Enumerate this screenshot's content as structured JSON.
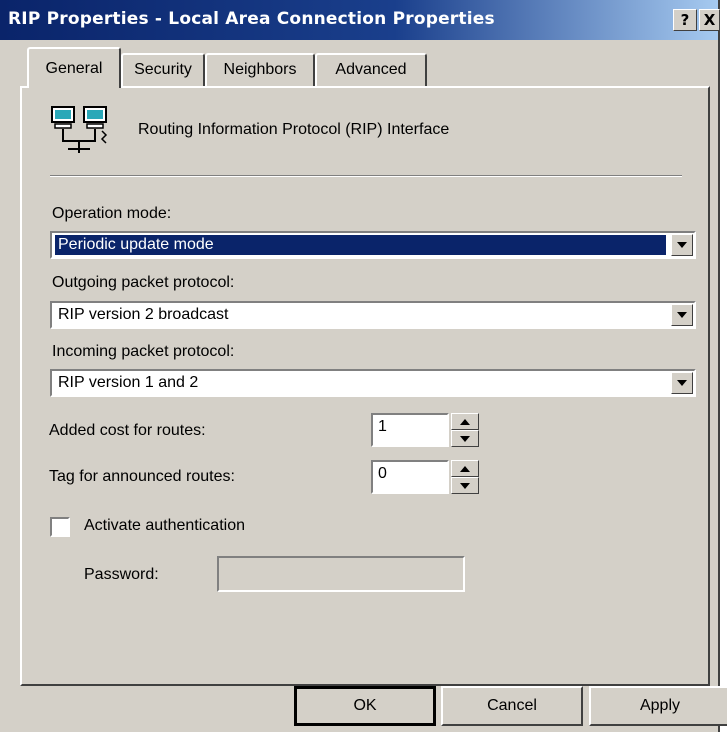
{
  "window": {
    "title": "RIP Properties - Local Area Connection Properties",
    "help_label": "?",
    "close_label": "X"
  },
  "tabs": [
    {
      "label": "General",
      "active": true
    },
    {
      "label": "Security",
      "active": false
    },
    {
      "label": "Neighbors",
      "active": false
    },
    {
      "label": "Advanced",
      "active": false
    }
  ],
  "header": {
    "icon": "network-icon",
    "text": "Routing Information Protocol (RIP) Interface"
  },
  "operation_mode": {
    "label": "Operation mode:",
    "value": "Periodic update mode"
  },
  "outgoing_protocol": {
    "label": "Outgoing packet protocol:",
    "value": "RIP version 2 broadcast"
  },
  "incoming_protocol": {
    "label": "Incoming packet protocol:",
    "value": "RIP version 1 and 2"
  },
  "added_cost": {
    "label": "Added cost for routes:",
    "value": "1"
  },
  "route_tag": {
    "label": "Tag for announced routes:",
    "value": "0"
  },
  "authentication": {
    "label": "Activate authentication",
    "checked": false,
    "password_label": "Password:",
    "password_value": ""
  },
  "buttons": {
    "ok": "OK",
    "cancel": "Cancel",
    "apply": "Apply"
  },
  "colors": {
    "face": "#d4d0c8",
    "title_start": "#0a246a",
    "title_end": "#a6caf0",
    "selection": "#0a246a"
  }
}
